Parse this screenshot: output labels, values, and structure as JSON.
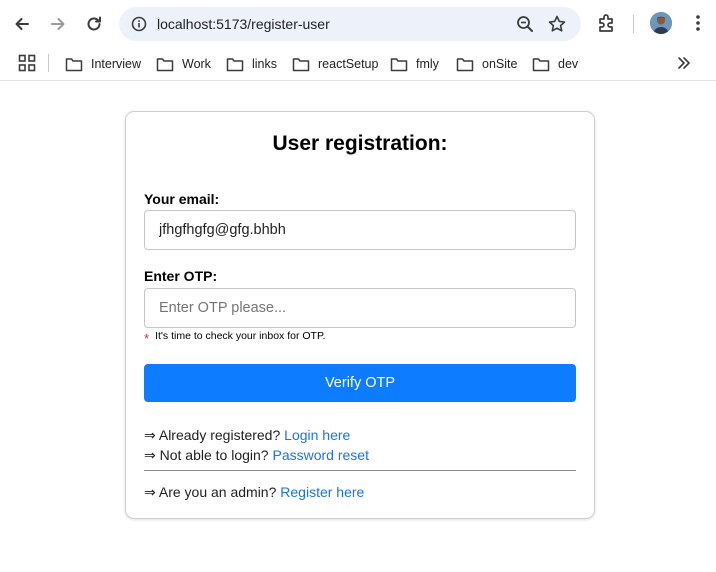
{
  "browser": {
    "url": "localhost:5173/register-user",
    "bookmarks": [
      "Interview",
      "Work",
      "links",
      "reactSetup",
      "fmly",
      "onSite",
      "dev"
    ]
  },
  "icons": {
    "back": "arrow-left-icon",
    "forward": "arrow-right-icon",
    "reload": "reload-icon",
    "site_info": "site-info-icon",
    "zoom": "zoom-icon",
    "bookmark_star": "star-icon",
    "extensions": "puzzle-icon",
    "menu": "kebab-menu-icon",
    "apps": "apps-grid-icon",
    "folder": "folder-icon",
    "more": "chevron-double-right-icon"
  },
  "form": {
    "title": "User registration:",
    "email_label": "Your email:",
    "email_value": "jfhgfhgfg@gfg.bhbh",
    "otp_label": "Enter OTP:",
    "otp_value": "",
    "otp_placeholder": "Enter OTP please...",
    "hint_marker": "*",
    "hint_text": "It's time to check your inbox for OTP.",
    "verify_label": "Verify OTP"
  },
  "links": {
    "arrow": "⇒",
    "login_prompt": "Already registered?",
    "login_link": "Login here",
    "reset_prompt": "Not able to login?",
    "reset_link": "Password reset",
    "admin_prompt": "Are you an admin?",
    "admin_link": "Register here"
  },
  "colors": {
    "primary_button": "#0d7cff",
    "link": "#1a73e8",
    "omnibox_bg": "#edf2fa",
    "required_marker": "#d93025"
  }
}
